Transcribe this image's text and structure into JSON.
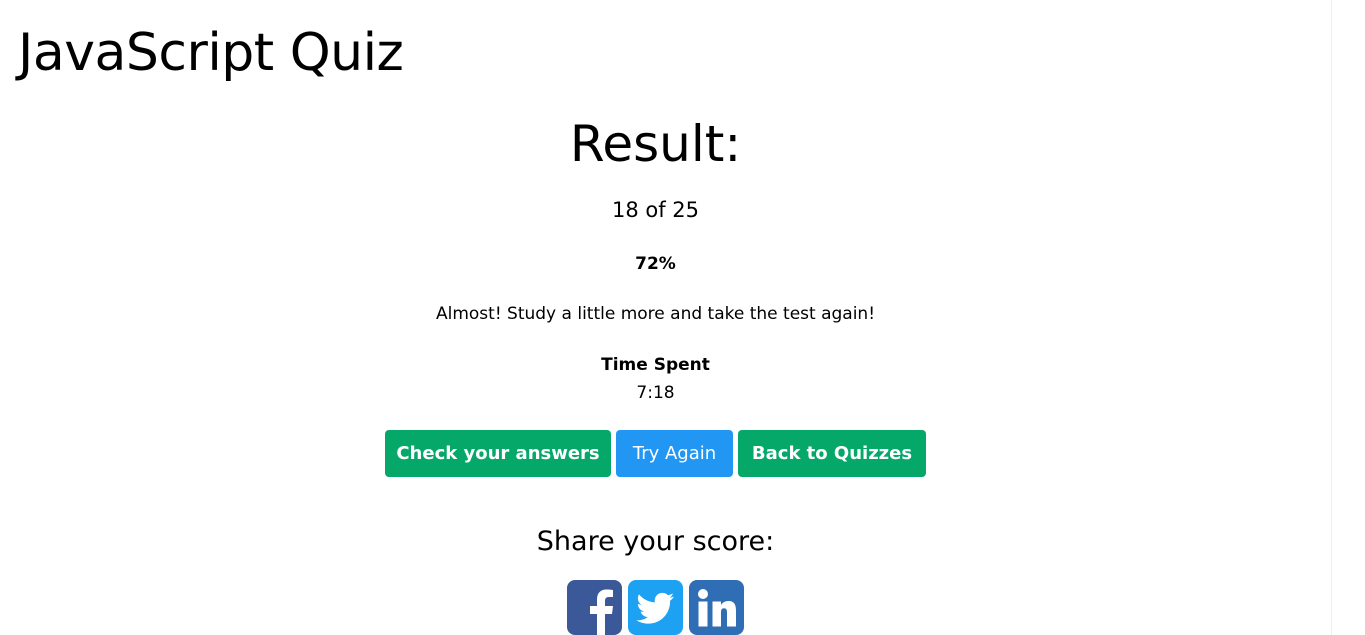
{
  "page": {
    "title": "JavaScript Quiz"
  },
  "result": {
    "heading": "Result:",
    "score_text": "18 of 25",
    "correct": 18,
    "total": 25,
    "percent_text": "72%",
    "message": "Almost! Study a little more and take the test again!",
    "time_label": "Time Spent",
    "time_value": "7:18"
  },
  "actions": {
    "check_label": "Check your answers",
    "try_again_label": "Try Again",
    "back_label": "Back to Quizzes"
  },
  "share": {
    "heading": "Share your score:",
    "networks": [
      {
        "name": "facebook-icon",
        "color": "#3b5998"
      },
      {
        "name": "twitter-icon",
        "color": "#1da1f2"
      },
      {
        "name": "linkedin-icon",
        "color": "#2f6eb5"
      }
    ]
  },
  "colors": {
    "green_button": "#06a86a",
    "blue_button": "#2196f3"
  }
}
